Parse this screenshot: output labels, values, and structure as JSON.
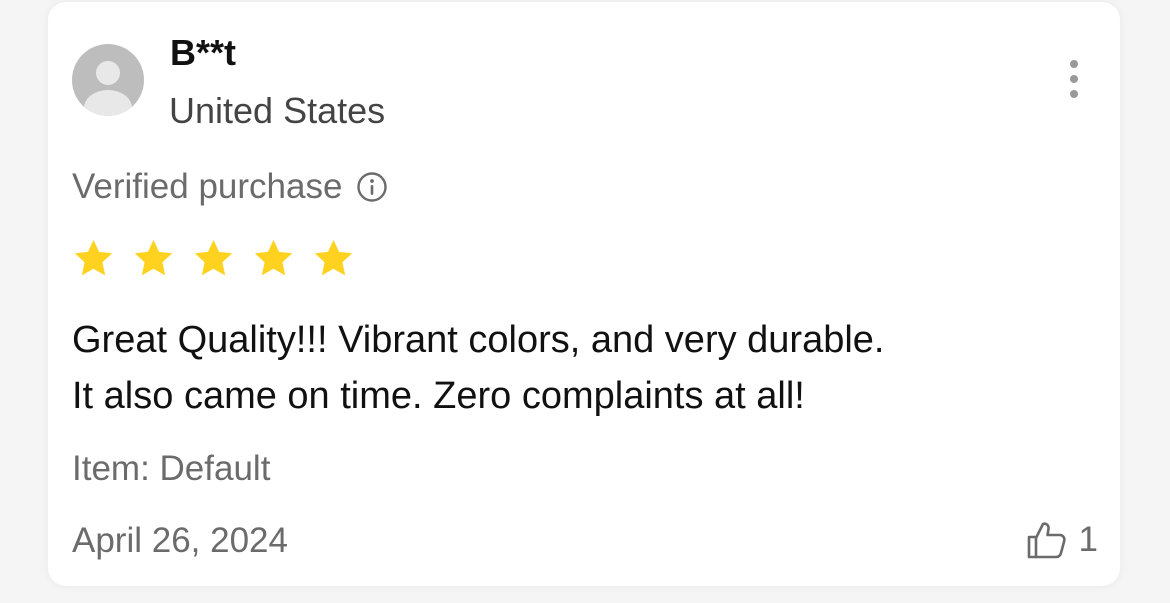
{
  "review": {
    "username": "B**t",
    "country": "United States",
    "verified_label": "Verified purchase",
    "rating": 5,
    "star_color": "#FFD21F",
    "text_line1": "Great Quality!!! Vibrant colors, and very durable.",
    "text_line2": "It also came on time. Zero complaints at all!",
    "item": "Item: Default",
    "date": "April 26, 2024",
    "like_count": "1"
  },
  "icons": {
    "avatar": "user-avatar-placeholder",
    "more": "more-vertical-icon",
    "info": "info-circle-icon",
    "star": "star-icon",
    "like": "thumbs-up-icon"
  }
}
